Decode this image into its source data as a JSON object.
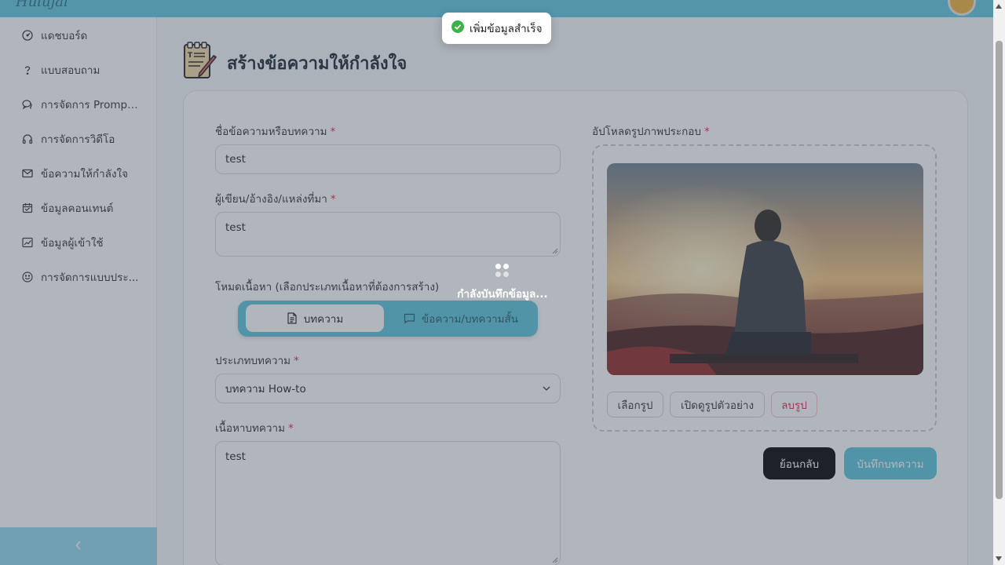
{
  "app": {
    "logo_text": "Hulujai"
  },
  "toast": {
    "message": "เพิ่มข้อมูลสำเร็จ",
    "color": "#3cb34a"
  },
  "sidebar": {
    "items": [
      {
        "label": "แดชบอร์ด",
        "icon": "gauge-icon"
      },
      {
        "label": "แบบสอบถาม",
        "icon": "question-icon"
      },
      {
        "label": "การจัดการ Prompt...",
        "icon": "chat-bubbles-icon"
      },
      {
        "label": "การจัดการวิดีโอ",
        "icon": "headphones-icon"
      },
      {
        "label": "ข้อความให้กำลังใจ",
        "icon": "mail-icon"
      },
      {
        "label": "ข้อมูลคอนเทนต์",
        "icon": "calendar-icon"
      },
      {
        "label": "ข้อมูลผู้เข้าใช้",
        "icon": "chart-line-icon"
      },
      {
        "label": "การจัดการแบบประ...",
        "icon": "smile-icon"
      }
    ]
  },
  "page": {
    "title": "สร้างข้อความให้กำลังใจ"
  },
  "form": {
    "title_label": "ชื่อข้อความหรือบทความ",
    "title_value": "test",
    "author_label": "ผู้เขียน/อ้างอิง/แหล่งที่มา",
    "author_value": "test",
    "mode_label": "โหมดเนื้อหา (เลือกประเภทเนื้อหาที่ต้องการสร้าง)",
    "mode_options": [
      "บทความ",
      "ข้อความ/บทความสั้น"
    ],
    "type_label": "ประเภทบทความ",
    "type_value": "บทความ How-to",
    "content_label": "เนื้อหาบทความ",
    "content_value": "test",
    "required_mark": "*"
  },
  "upload": {
    "label": "อัปโหลดรูปภาพประกอบ",
    "choose": "เลือกรูป",
    "preview": "เปิดดูรูปตัวอย่าง",
    "remove": "ลบรูป"
  },
  "actions": {
    "back": "ย้อนกลับ",
    "save": "บันทึกบทความ"
  },
  "loading": {
    "text": "กำลังบันทึกข้อมูล..."
  },
  "colors": {
    "accent": "#5bc4dc",
    "required": "#e0245e",
    "back_button": "#000000"
  }
}
